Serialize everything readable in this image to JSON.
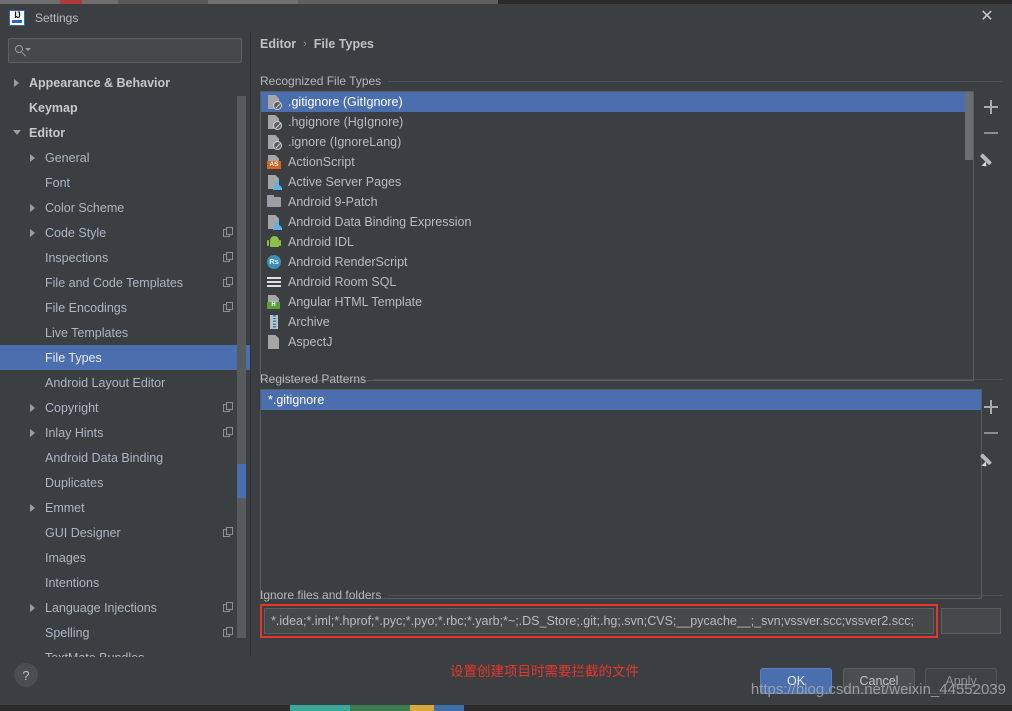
{
  "window": {
    "title": "Settings",
    "app_icon": "intellij-idea-icon",
    "close_label": "✕"
  },
  "search": {
    "value": "",
    "placeholder": ""
  },
  "sidebar": {
    "items": [
      {
        "label": "Appearance & Behavior",
        "level": 0,
        "twisty": "right",
        "copy": false,
        "selected": false
      },
      {
        "label": "Keymap",
        "level": 0,
        "twisty": "none",
        "copy": false,
        "selected": false
      },
      {
        "label": "Editor",
        "level": 0,
        "twisty": "down",
        "copy": false,
        "selected": false
      },
      {
        "label": "General",
        "level": 1,
        "twisty": "right",
        "copy": false,
        "selected": false
      },
      {
        "label": "Font",
        "level": 1,
        "twisty": "none",
        "copy": false,
        "selected": false
      },
      {
        "label": "Color Scheme",
        "level": 1,
        "twisty": "right",
        "copy": false,
        "selected": false
      },
      {
        "label": "Code Style",
        "level": 1,
        "twisty": "right",
        "copy": true,
        "selected": false
      },
      {
        "label": "Inspections",
        "level": 1,
        "twisty": "none",
        "copy": true,
        "selected": false
      },
      {
        "label": "File and Code Templates",
        "level": 1,
        "twisty": "none",
        "copy": true,
        "selected": false
      },
      {
        "label": "File Encodings",
        "level": 1,
        "twisty": "none",
        "copy": true,
        "selected": false
      },
      {
        "label": "Live Templates",
        "level": 1,
        "twisty": "none",
        "copy": false,
        "selected": false
      },
      {
        "label": "File Types",
        "level": 1,
        "twisty": "none",
        "copy": false,
        "selected": true
      },
      {
        "label": "Android Layout Editor",
        "level": 1,
        "twisty": "none",
        "copy": false,
        "selected": false
      },
      {
        "label": "Copyright",
        "level": 1,
        "twisty": "right",
        "copy": true,
        "selected": false
      },
      {
        "label": "Inlay Hints",
        "level": 1,
        "twisty": "right",
        "copy": true,
        "selected": false
      },
      {
        "label": "Android Data Binding",
        "level": 1,
        "twisty": "none",
        "copy": false,
        "selected": false
      },
      {
        "label": "Duplicates",
        "level": 1,
        "twisty": "none",
        "copy": false,
        "selected": false
      },
      {
        "label": "Emmet",
        "level": 1,
        "twisty": "right",
        "copy": false,
        "selected": false
      },
      {
        "label": "GUI Designer",
        "level": 1,
        "twisty": "none",
        "copy": true,
        "selected": false
      },
      {
        "label": "Images",
        "level": 1,
        "twisty": "none",
        "copy": false,
        "selected": false
      },
      {
        "label": "Intentions",
        "level": 1,
        "twisty": "none",
        "copy": false,
        "selected": false
      },
      {
        "label": "Language Injections",
        "level": 1,
        "twisty": "right",
        "copy": true,
        "selected": false
      },
      {
        "label": "Spelling",
        "level": 1,
        "twisty": "none",
        "copy": true,
        "selected": false
      },
      {
        "label": "TextMate Bundles",
        "level": 1,
        "twisty": "none",
        "copy": false,
        "selected": false
      }
    ]
  },
  "breadcrumb": {
    "parent": "Editor",
    "separator": "›",
    "current": "File Types"
  },
  "recognized": {
    "title": "Recognized File Types",
    "items": [
      {
        "label": ".gitignore (GitIgnore)",
        "icon": "ignore-file-icon",
        "selected": true
      },
      {
        "label": ".hgignore (HgIgnore)",
        "icon": "ignore-file-icon",
        "selected": false
      },
      {
        "label": ".ignore (IgnoreLang)",
        "icon": "ignore-file-icon",
        "selected": false
      },
      {
        "label": "ActionScript",
        "icon": "actionscript-icon",
        "selected": false
      },
      {
        "label": "Active Server Pages",
        "icon": "asp-file-icon",
        "selected": false
      },
      {
        "label": "Android 9-Patch",
        "icon": "folder-icon",
        "selected": false
      },
      {
        "label": "Android Data Binding Expression",
        "icon": "asp-file-icon",
        "selected": false
      },
      {
        "label": "Android IDL",
        "icon": "android-robot-icon",
        "selected": false
      },
      {
        "label": "Android RenderScript",
        "icon": "renderscript-icon",
        "selected": false
      },
      {
        "label": "Android Room SQL",
        "icon": "sql-table-icon",
        "selected": false
      },
      {
        "label": "Angular HTML Template",
        "icon": "angular-html-icon",
        "selected": false
      },
      {
        "label": "Archive",
        "icon": "archive-zip-icon",
        "selected": false
      },
      {
        "label": "AspectJ",
        "icon": "generic-file-icon",
        "selected": false
      }
    ],
    "toolbar": {
      "add": "+",
      "remove": "–",
      "edit": "pencil"
    }
  },
  "patterns": {
    "title": "Registered Patterns",
    "items": [
      {
        "label": "*.gitignore",
        "selected": true
      }
    ],
    "toolbar": {
      "add": "+",
      "remove": "–",
      "edit": "pencil"
    }
  },
  "ignore": {
    "title": "Ignore files and folders",
    "value": "*.idea;*.iml;*.hprof;*.pyc;*.pyo;*.rbc;*.yarb;*~;.DS_Store;.git;.hg;.svn;CVS;__pycache__;_svn;vssver.scc;vssver2.scc;",
    "highlight_color": "#e8352c"
  },
  "footer": {
    "help": "?",
    "ok": "OK",
    "cancel": "Cancel",
    "apply": "Apply"
  },
  "annotation": {
    "text": "设置创建项目时需要拦截的文件",
    "color": "#e8352c"
  },
  "watermark": {
    "text": "https://blog.csdn.net/weixin_44552039"
  },
  "theme": {
    "bg": "#3c3f41",
    "selection": "#4b6eaf",
    "text": "#bbbbbb",
    "tree_text": "#a9b7c6"
  }
}
